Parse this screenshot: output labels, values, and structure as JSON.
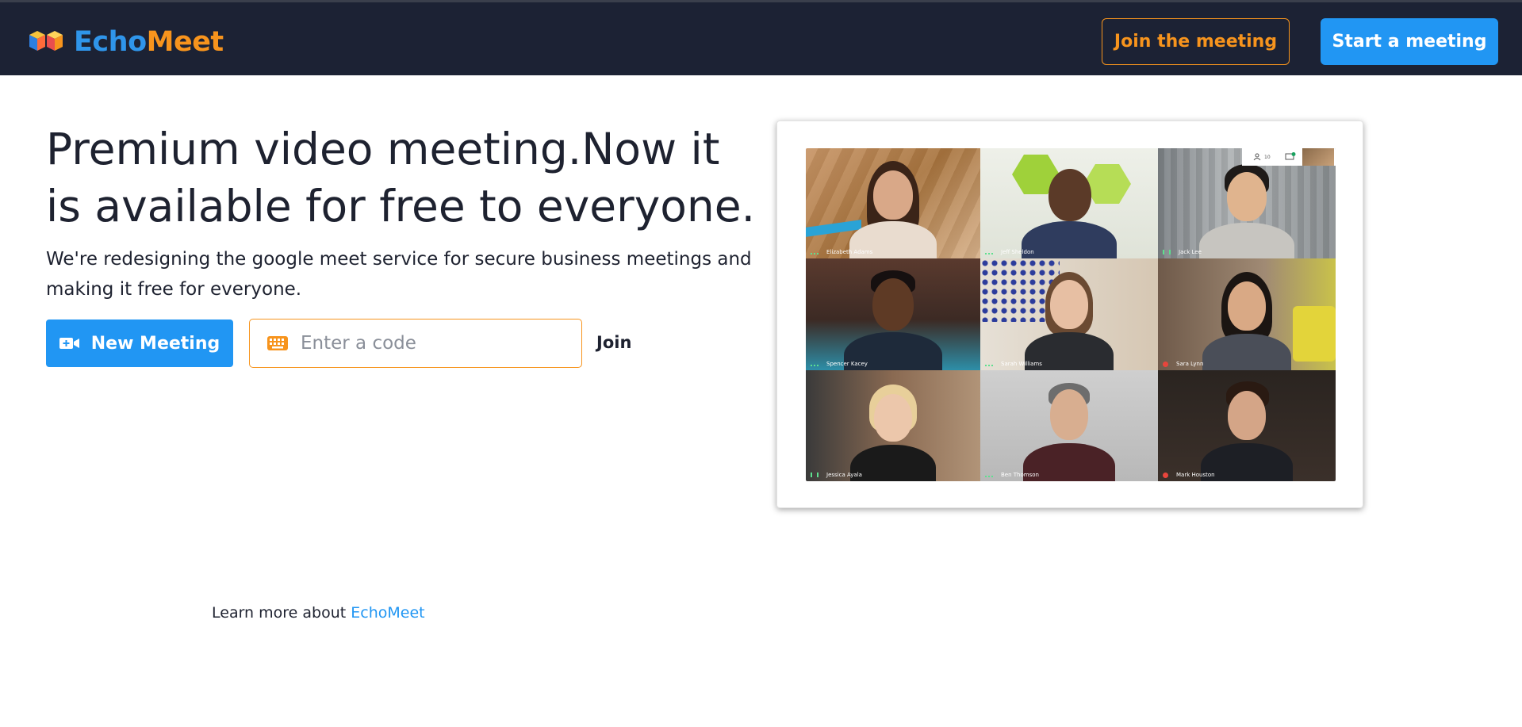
{
  "brand": {
    "name_part1": "Echo",
    "name_part2": "Meet",
    "accent_blue": "#2196f3",
    "accent_orange": "#f7941d",
    "nav_bg": "#1c2234"
  },
  "nav": {
    "join_label": "Join the meeting",
    "start_label": "Start a meeting"
  },
  "hero": {
    "title": "Premium video meeting.Now it is available for free to everyone.",
    "subtitle": "We're redesigning the google meet service for secure business meetings and making it free for everyone."
  },
  "actions": {
    "new_meeting_label": "New Meeting",
    "code_placeholder": "Enter a code",
    "join_label": "Join"
  },
  "preview": {
    "participants": [
      {
        "name": "Elizabeth Adams",
        "indicator": "dots"
      },
      {
        "name": "Jeff Sheldon",
        "indicator": "dots"
      },
      {
        "name": "Jack Lee",
        "indicator": "bars"
      },
      {
        "name": "Spencer Kacey",
        "indicator": "dots"
      },
      {
        "name": "Sarah Williams",
        "indicator": "dots"
      },
      {
        "name": "Sara Lynn",
        "indicator": "muted"
      },
      {
        "name": "Jessica Ayala",
        "indicator": "bars"
      },
      {
        "name": "Ben Thomson",
        "indicator": "dots"
      },
      {
        "name": "Mark Houston",
        "indicator": "muted"
      }
    ],
    "participant_count": "10",
    "chat_badge": "1"
  },
  "footer": {
    "learn_prefix": "Learn more about ",
    "learn_link": "EchoMeet"
  }
}
